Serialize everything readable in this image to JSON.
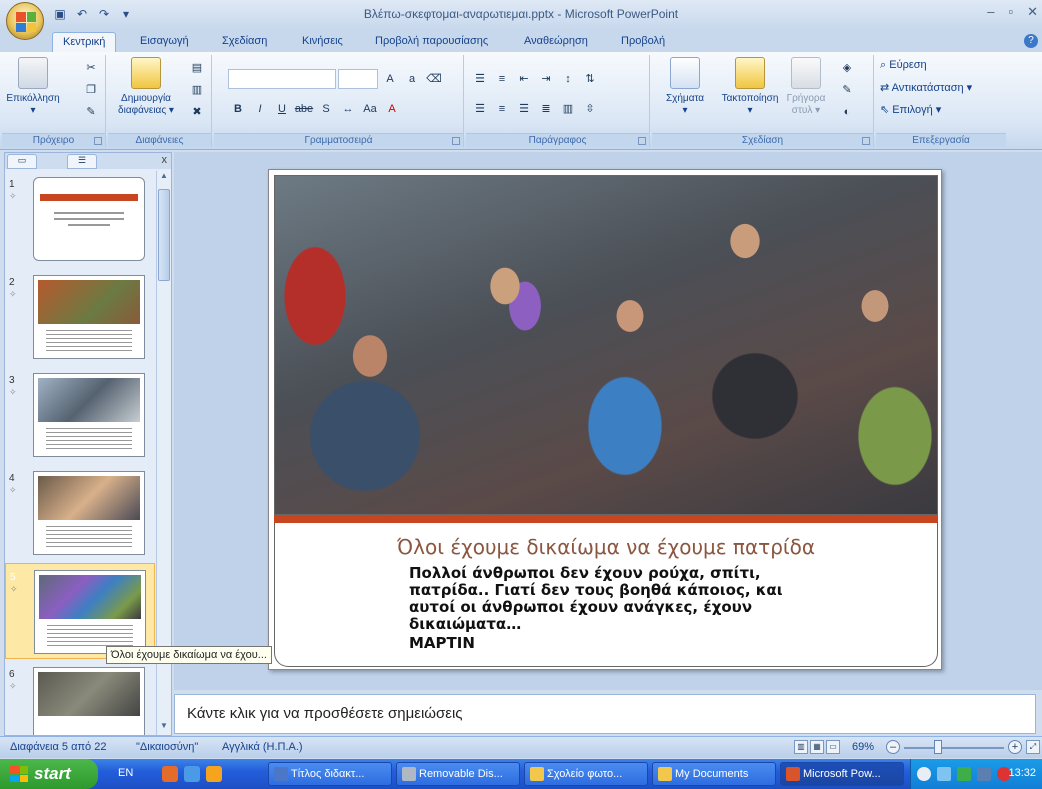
{
  "window": {
    "title": "Βλέπω-σκεφτομαι-αναρωτιεμαι.pptx - Microsoft PowerPoint"
  },
  "tabs": [
    "Κεντρική",
    "Εισαγωγή",
    "Σχεδίαση",
    "Κινήσεις",
    "Προβολή παρουσίασης",
    "Αναθεώρηση",
    "Προβολή"
  ],
  "ribbon": {
    "clipboard": {
      "paste": "Επικόλληση",
      "label": "Πρόχειρο"
    },
    "slides": {
      "new_slide_line1": "Δημιουργία",
      "new_slide_line2": "διαφάνειας",
      "label": "Διαφάνειες"
    },
    "font": {
      "label": "Γραμματοσειρά"
    },
    "paragraph": {
      "label": "Παράγραφος"
    },
    "drawing": {
      "shapes": "Σχήματα",
      "arrange": "Τακτοποίηση",
      "quick_styles_line1": "Γρήγορα",
      "quick_styles_line2": "στυλ",
      "label": "Σχεδίαση"
    },
    "editing": {
      "find": "Εύρεση",
      "replace": "Αντικατάσταση",
      "select": "Επιλογή",
      "label": "Επεξεργασία"
    }
  },
  "slides": [
    {
      "num": "1",
      "selected": false
    },
    {
      "num": "2",
      "selected": false
    },
    {
      "num": "3",
      "selected": false
    },
    {
      "num": "4",
      "selected": false
    },
    {
      "num": "5",
      "selected": true
    },
    {
      "num": "6",
      "selected": false
    }
  ],
  "tooltip": "Όλοι έχουμε δικαίωμα να έχου...",
  "slide": {
    "title": "Όλοι έχουμε δικαίωμα να έχουμε πατρίδα",
    "body": "Πολλοί άνθρωποι δεν έχουν ρούχα, σπίτι, πατρίδα.. Γιατί δεν τους βοηθά κάποιος, και αυτοί οι άνθρωποι έχουν ανάγκες, έχουν δικαιώματα…",
    "author": "ΜΑΡΤΙΝ"
  },
  "notes_placeholder": "Κάντε κλικ για να προσθέσετε σημειώσεις",
  "status": {
    "slide_info": "Διαφάνεια 5 από 22",
    "theme": "\"Δικαιοσύνη\"",
    "language": "Αγγλικά (Η.Π.Α.)",
    "zoom": "69%"
  },
  "taskbar": {
    "start": "start",
    "lang": "EN",
    "buttons": [
      {
        "label": "Τίτλος διδακτ...",
        "icon_color": "#4a77c8"
      },
      {
        "label": "Removable Dis...",
        "icon_color": "#b0b8c4"
      },
      {
        "label": "Σχολείο φωτο...",
        "icon_color": "#f1c84b"
      },
      {
        "label": "My Documents",
        "icon_color": "#f1c84b"
      },
      {
        "label": "Microsoft Pow...",
        "icon_color": "#d9532b"
      }
    ],
    "clock": "13:32"
  },
  "colors": {
    "accent_band": "#c8461f",
    "slide_title": "#8a5640",
    "ribbon_blue": "#15428b"
  }
}
